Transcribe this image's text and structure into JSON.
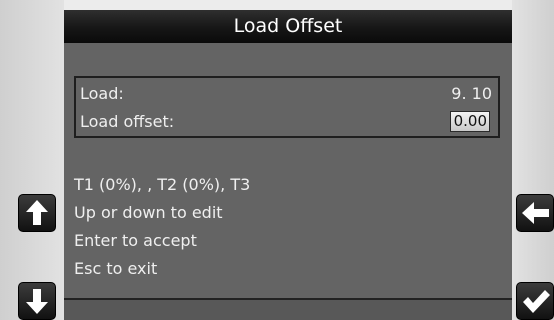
{
  "screen": {
    "title": "Load Offset",
    "load": {
      "label": "Load:",
      "value": "9. 10"
    },
    "load_offset": {
      "label": "Load offset:",
      "value": "0.00"
    },
    "status_line": "T1 (0%), , T2 (0%), T3",
    "instructions": [
      "Up or down to edit",
      "Enter to accept",
      "Esc to exit"
    ]
  },
  "buttons": {
    "up": "arrow-up-icon",
    "down": "arrow-down-icon",
    "back": "arrow-left-icon",
    "accept": "checkmark-icon"
  }
}
